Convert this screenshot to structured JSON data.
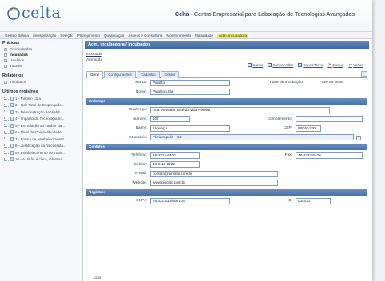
{
  "header": {
    "logo_text": "celta",
    "title_bold": "Celta",
    "title_rest": " - Centro Empresarial para Laboração de Tecnologias Avançadas"
  },
  "menu": [
    "Gestão Básica",
    "Sensibilização",
    "Seleção",
    "Planejamento",
    "Qualificação",
    "Assess e Consultoria",
    "Monitoramento",
    "Maturidade",
    "Adm. Incubadora"
  ],
  "sidebar": {
    "praticas_title": "Práticas",
    "praticas": [
      "Preincubados",
      "Incubados",
      "Usuários",
      "Tutores"
    ],
    "relatorios_title": "Relatórios",
    "relatorios": [
      "Incubados"
    ],
    "ultimos_title": "Últimos registros",
    "ultimos": [
      "1 - Pinolito Ltda",
      "3 - Qde Total de Empregado...",
      "3 - Demonstração de Viabili...",
      "4 - Impacto da Tecnologia no...",
      "5 - Em relação ao caráter da...",
      "6 - Nível de Competitividade ...",
      "7 - Forma de estabelecimento...",
      "8 - Justificação da Necessida...",
      "9 - Estabelecimento de Tutor...",
      "10 - A Visão é clara, Objetiva..."
    ]
  },
  "main": {
    "title": "Adm. Incubadora / Incubados",
    "breadcrumb1": "Incubado",
    "breadcrumb2": "Alteração",
    "toolbar": [
      "Salvar",
      "Salvar/Voltar",
      "Salvar/Novo",
      "Excluir",
      "Voltar"
    ],
    "tabs": [
      "Geral",
      "Configurações",
      "Cadastro",
      "Gestor"
    ],
    "fields": {
      "marca_label": "Marca:",
      "marca_value": "Pinolito",
      "fase_label": "Fase de Incubação:",
      "fase_value": "Fase de Teste",
      "nome_label": "Nome:",
      "nome_value": "Pinolito Ltda"
    },
    "sections": {
      "endereco": "Endereço",
      "contatos": "Contatos",
      "registros": "Registros"
    },
    "endereco": {
      "endereco_label": "Endereço:",
      "endereco_value": "Rua Vereador José da Vida Pereira",
      "numero_label": "Número:",
      "numero_value": "107",
      "complemento_label": "Complemento:",
      "complemento_value": "",
      "bairro_label": "Bairro:",
      "bairro_value": "Itaguaçu",
      "cep_label": "CEP:",
      "cep_value": "88040-200",
      "municipio_label": "Município:",
      "municipio_value": "Florianópolis - SC"
    },
    "contatos": {
      "telefone_label": "Telefone:",
      "telefone_value": "48-3222-5400",
      "fax_label": "Fax:",
      "fax_value": "48-3222-5400",
      "celular_label": "Celular:",
      "celular_value": "48-9111-2222",
      "email_label": "E-mail:",
      "email_value": "contato@pinolito.com.br",
      "website_label": "Website:",
      "website_value": "www.pinolito.com.br"
    },
    "registros": {
      "cnpj_label": "CNPJ:",
      "cnpj_value": "76.321.530/0001-30",
      "ie_label": "IE:",
      "ie_value": "000031"
    },
    "footer_label": "Logo:"
  }
}
